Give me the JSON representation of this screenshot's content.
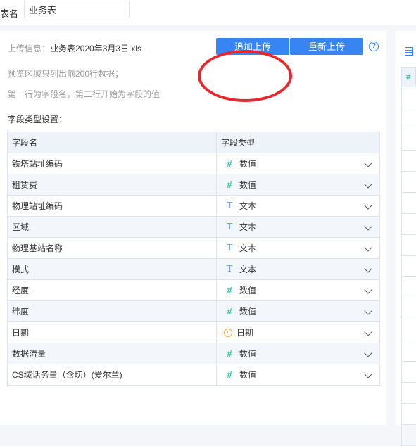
{
  "header": {
    "table_name_label": "表名",
    "table_name_value": "业务表"
  },
  "upload": {
    "info_label": "上传信息：",
    "file_name": "业务表2020年3月3日.xls",
    "append_button": "追加上传",
    "reupload_button": "重新上传",
    "help_icon": "question-circle-icon",
    "help_glyph": "?"
  },
  "notes": {
    "line1": "预览区域只列出前200行数据；",
    "line2": "第一行为字段名，第二行开始为字段的值"
  },
  "field_settings": {
    "title": "字段类型设置：",
    "columns": [
      "字段名",
      "字段类型"
    ],
    "rows": [
      {
        "name": "铁塔站址编码",
        "type": "数值",
        "icon": "#"
      },
      {
        "name": "租赁费",
        "type": "数值",
        "icon": "#"
      },
      {
        "name": "物理站址编码",
        "type": "文本",
        "icon": "T"
      },
      {
        "name": "区域",
        "type": "文本",
        "icon": "T"
      },
      {
        "name": "物理基站名称",
        "type": "文本",
        "icon": "T"
      },
      {
        "name": "模式",
        "type": "文本",
        "icon": "T"
      },
      {
        "name": "经度",
        "type": "数值",
        "icon": "#"
      },
      {
        "name": "纬度",
        "type": "数值",
        "icon": "#"
      },
      {
        "name": "日期",
        "type": "日期",
        "icon": "clock"
      },
      {
        "name": "数据流量",
        "type": "数值",
        "icon": "#"
      },
      {
        "name": "CS域话务量（含切）(爱尔兰)",
        "type": "数值",
        "icon": "#"
      }
    ]
  },
  "preview": {
    "grid_icon": "table-grid-icon",
    "header_glyph": "#"
  },
  "colors": {
    "primary": "#3685f2",
    "number_icon": "#2fbf9f",
    "date_icon": "#f5a142",
    "annotation_circle": "#e8262b"
  }
}
